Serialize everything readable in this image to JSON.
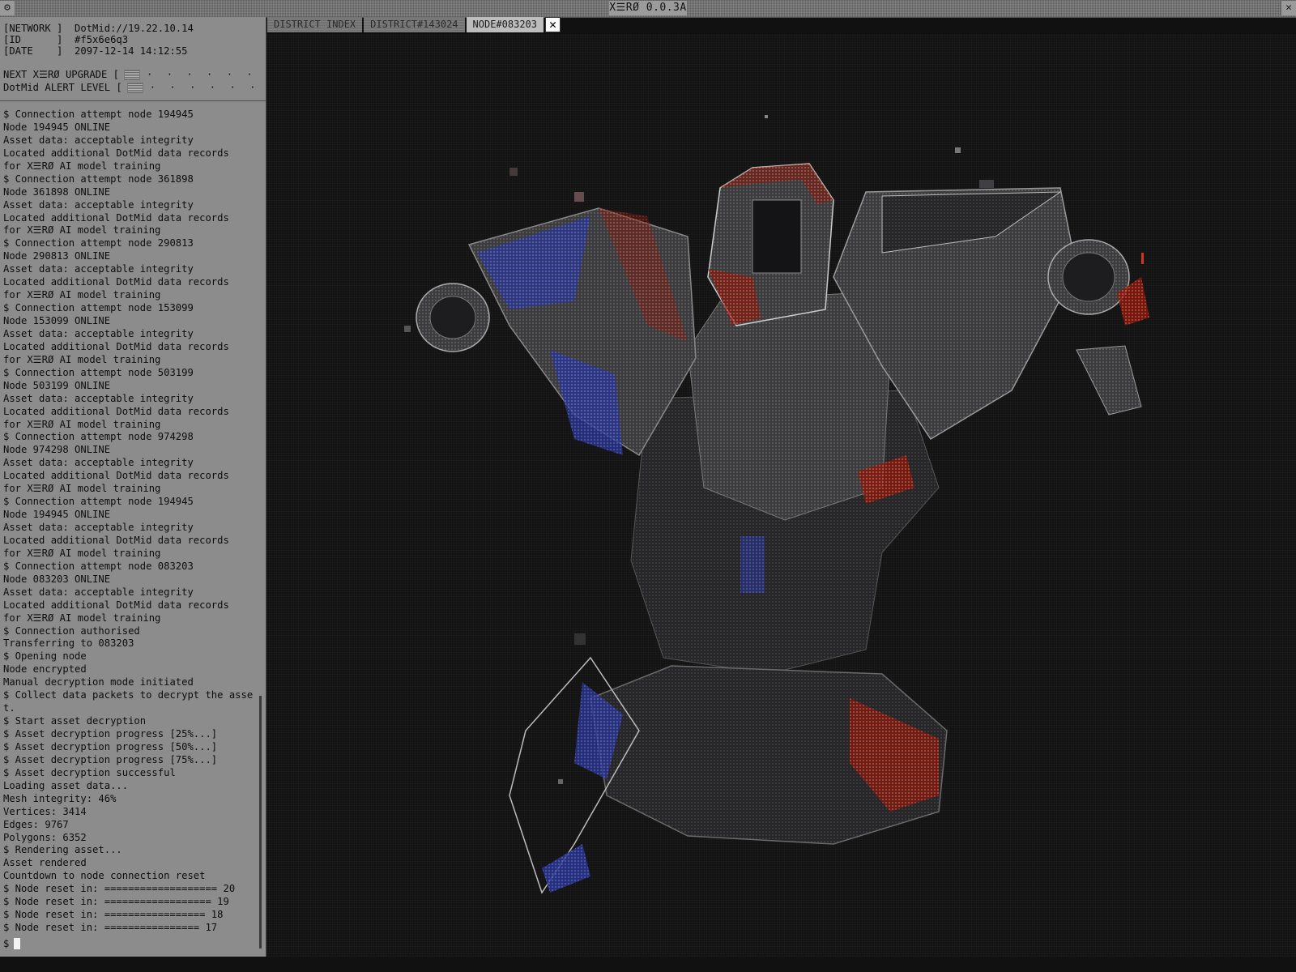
{
  "window": {
    "title": "X☰RØ 0.0.3A",
    "gear_icon": "gear-icon",
    "close_icon": "close-icon"
  },
  "status": {
    "network": "[NETWORK ]  DotMid://19.22.10.14",
    "id": "[ID      ]  #f5x6e6q3",
    "date": "[DATE    ]  2097-12-14 14:12:55",
    "upgrade_label": "NEXT X☰RØ UPGRADE [",
    "upgrade_level": 0.35,
    "alert_label": "DotMid ALERT LEVEL [",
    "alert_level": 0.35,
    "bar_close": "]",
    "bar_dots": "· · · · · · · ·"
  },
  "log": [
    "$ Connection attempt node 194945",
    "Node 194945 ONLINE",
    "Asset data: acceptable integrity",
    "Located additional DotMid data records",
    "for X☰RØ AI model training",
    "$ Connection attempt node 361898",
    "Node 361898 ONLINE",
    "Asset data: acceptable integrity",
    "Located additional DotMid data records",
    "for X☰RØ AI model training",
    "$ Connection attempt node 290813",
    "Node 290813 ONLINE",
    "Asset data: acceptable integrity",
    "Located additional DotMid data records",
    "for X☰RØ AI model training",
    "$ Connection attempt node 153099",
    "Node 153099 ONLINE",
    "Asset data: acceptable integrity",
    "Located additional DotMid data records",
    "for X☰RØ AI model training",
    "$ Connection attempt node 503199",
    "Node 503199 ONLINE",
    "Asset data: acceptable integrity",
    "Located additional DotMid data records",
    "for X☰RØ AI model training",
    "$ Connection attempt node 974298",
    "Node 974298 ONLINE",
    "Asset data: acceptable integrity",
    "Located additional DotMid data records",
    "for X☰RØ AI model training",
    "$ Connection attempt node 194945",
    "Node 194945 ONLINE",
    "Asset data: acceptable integrity",
    "Located additional DotMid data records",
    "for X☰RØ AI model training",
    "$ Connection attempt node 083203",
    "Node 083203 ONLINE",
    "Asset data: acceptable integrity",
    "Located additional DotMid data records",
    "for X☰RØ AI model training",
    "$ Connection authorised",
    "Transferring to 083203",
    "$ Opening node",
    "Node encrypted",
    "Manual decryption mode initiated",
    "$ Collect data packets to decrypt the asse",
    "t.",
    "$ Start asset decryption",
    "$ Asset decryption progress [25%...]",
    "$ Asset decryption progress [50%...]",
    "$ Asset decryption progress [75%...]",
    "$ Asset decryption successful",
    "Loading asset data...",
    "Mesh integrity: 46%",
    "Vertices: 3414",
    "Edges: 9767",
    "Polygons: 6352",
    "$ Rendering asset...",
    "Asset rendered",
    "Countdown to node connection reset",
    "$ Node reset in: =================== 20",
    "$ Node reset in: ================== 19",
    "$ Node reset in: ================= 18",
    "$ Node reset in: ================ 17"
  ],
  "prompt": "$",
  "tabs": [
    {
      "label": "DISTRICT INDEX",
      "active": false
    },
    {
      "label": "DISTRICT#143024",
      "active": false
    },
    {
      "label": "NODE#083203",
      "active": true
    }
  ],
  "tab_close_icon": "close-icon",
  "viewport": {
    "asset_icon": "mech-asset-render",
    "colors": {
      "background": "#121212",
      "mesh": "#4a4a4a",
      "red": "#d8361e",
      "blue": "#3a4fd0"
    }
  }
}
